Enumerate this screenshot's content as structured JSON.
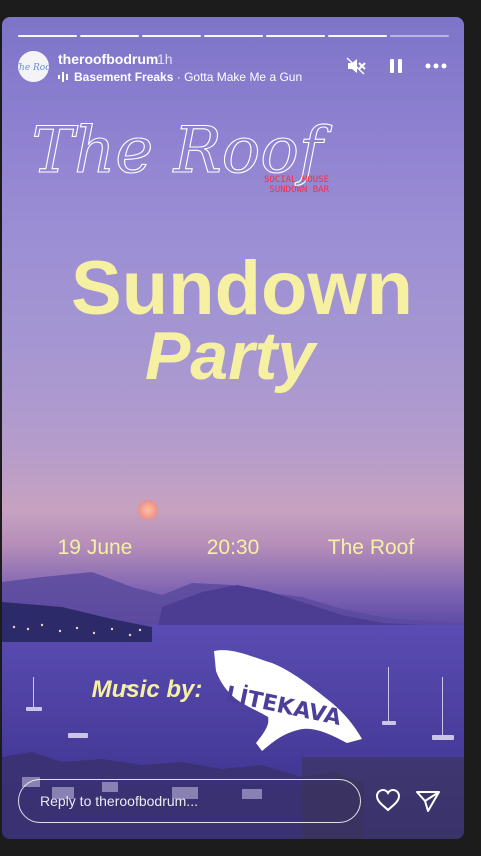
{
  "story": {
    "progress": {
      "total": 7,
      "current": 7
    },
    "username": "theroofbodrum",
    "time_ago": "1h",
    "music": {
      "artist": "Basement Freaks",
      "separator": "·",
      "track": "Gotta Make Me a Gun"
    },
    "reply_placeholder": "Reply to theroofbodrum..."
  },
  "poster": {
    "brand": "The Roof",
    "tagline_1": "SOCIAL HOUSE",
    "tagline_2": "SUNDOWN BAR",
    "title_1": "Sundown",
    "title_2": "Party",
    "date": "19 June",
    "time": "20:30",
    "venue": "The Roof",
    "music_by": "Music by:",
    "dj": "LİTEKAVA"
  },
  "colors": {
    "title": "#f6f0a2",
    "tagline": "#ff2a4a",
    "text": "#ffffff"
  }
}
